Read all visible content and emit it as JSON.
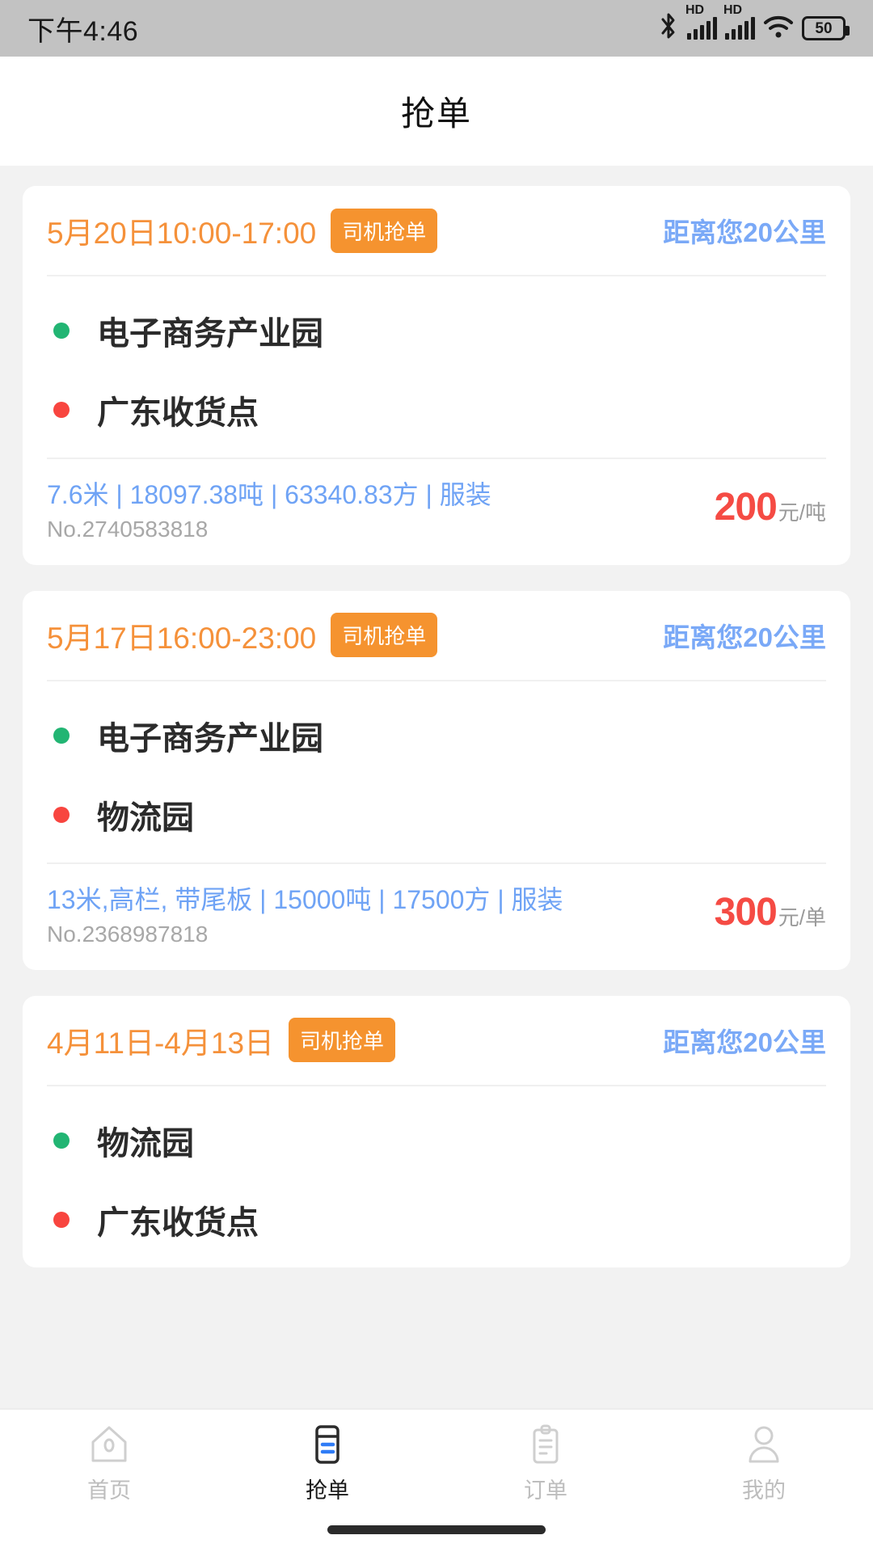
{
  "status_bar": {
    "time": "下午4:46",
    "battery_level": "50",
    "icons": [
      "bluetooth-icon",
      "hd-signal-icon",
      "hd-signal-icon",
      "wifi-icon",
      "battery-icon"
    ]
  },
  "header": {
    "title": "抢单"
  },
  "colors": {
    "accent_orange": "#f5932f",
    "date_orange": "#f5913a",
    "distance_blue": "#7aa9f7",
    "spec_blue": "#6fa3f5",
    "price_red": "#f54b44",
    "start_dot_green": "#22b573",
    "end_dot_red": "#f8453f",
    "page_bg": "#f2f2f2",
    "status_bar_bg": "#c2c2c2"
  },
  "orders": [
    {
      "date": "5月20日10:00-17:00",
      "badge": "司机抢单",
      "distance": "距离您20公里",
      "start": "电子商务产业园",
      "end": "广东收货点",
      "spec": "7.6米 | 18097.38吨 | 63340.83方 | 服装",
      "order_no": "No.2740583818",
      "price": "200",
      "price_unit": "元/吨"
    },
    {
      "date": "5月17日16:00-23:00",
      "badge": "司机抢单",
      "distance": "距离您20公里",
      "start": "电子商务产业园",
      "end": "物流园",
      "spec": "13米,高栏, 带尾板 | 15000吨 | 17500方 | 服装",
      "order_no": "No.2368987818",
      "price": "300",
      "price_unit": "元/单"
    },
    {
      "date": "4月11日-4月13日",
      "badge": "司机抢单",
      "distance": "距离您20公里",
      "start": "物流园",
      "end": "广东收货点",
      "spec": "",
      "order_no": "",
      "price": "",
      "price_unit": ""
    }
  ],
  "tabbar": {
    "items": [
      {
        "label": "首页",
        "icon": "home-icon",
        "active": false
      },
      {
        "label": "抢单",
        "icon": "grab-order-icon",
        "active": true
      },
      {
        "label": "订单",
        "icon": "clipboard-icon",
        "active": false
      },
      {
        "label": "我的",
        "icon": "person-icon",
        "active": false
      }
    ]
  }
}
